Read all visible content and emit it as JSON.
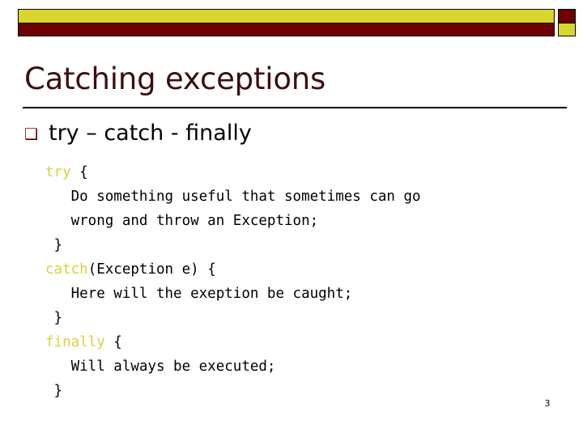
{
  "slide": {
    "title": "Catching exceptions",
    "page_number": "3",
    "colors": {
      "accent_yellow": "#d9d62e",
      "accent_dark_red": "#6d0000",
      "title_text": "#3d0f0f",
      "keyword_yellow": "#d6d23c",
      "body_text": "#000000",
      "background": "#ffffff"
    }
  },
  "header": {
    "yellow_bar": "decorative-yellow-bar",
    "red_bar": "decorative-dark-red-bar",
    "red_square": "decorative-dark-red-square",
    "yellow_square": "decorative-yellow-square"
  },
  "bullet": {
    "marker": "❑",
    "text": "try – catch - finally"
  },
  "code": {
    "lines": [
      {
        "keyword": "try",
        "rest": " {"
      },
      {
        "keyword": "",
        "rest": "   Do something useful that sometimes can go"
      },
      {
        "keyword": "",
        "rest": "   wrong and throw an Exception;"
      },
      {
        "keyword": "",
        "rest": " }"
      },
      {
        "keyword": "catch",
        "rest": "(Exception e) {"
      },
      {
        "keyword": "",
        "rest": "   Here will the exeption be caught;"
      },
      {
        "keyword": "",
        "rest": " }"
      },
      {
        "keyword": "finally",
        "rest": " {"
      },
      {
        "keyword": "",
        "rest": "   Will always be executed;"
      },
      {
        "keyword": "",
        "rest": " }"
      }
    ]
  }
}
